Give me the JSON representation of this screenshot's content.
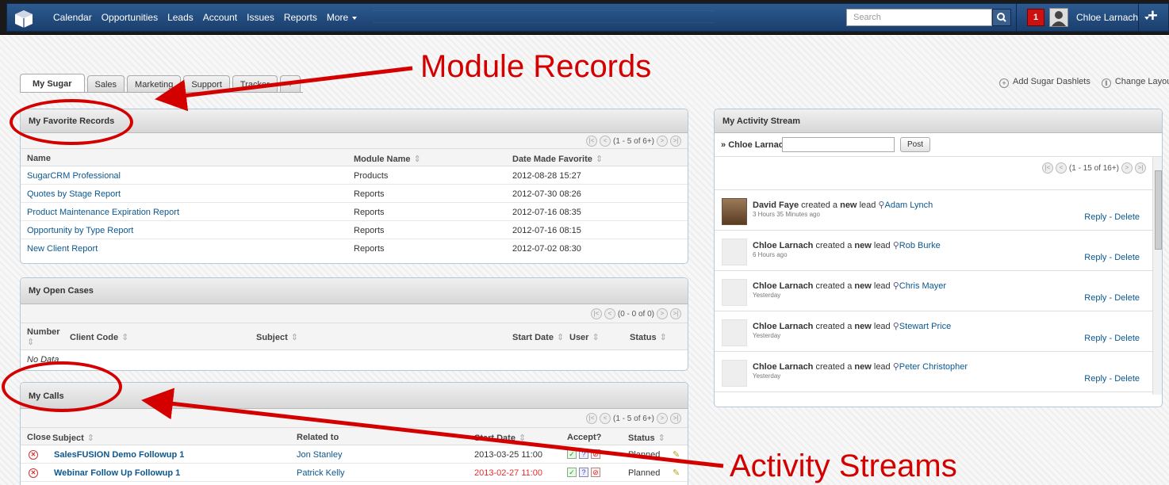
{
  "nav": {
    "items": [
      "Calendar",
      "Opportunities",
      "Leads",
      "Account",
      "Issues",
      "Reports",
      "More"
    ],
    "search_placeholder": "Search",
    "notifications": "1",
    "user": "Chloe Larnach"
  },
  "tabs": [
    "My Sugar",
    "Sales",
    "Marketing",
    "Support",
    "Tracker",
    "+"
  ],
  "dash_actions": {
    "add": "Add Sugar Dashlets",
    "layout": "Change Layout"
  },
  "favorites": {
    "title": "My Favorite Records",
    "pager": "(1 - 5 of 6+)",
    "columns": [
      "Name",
      "Module Name",
      "Date Made Favorite"
    ],
    "rows": [
      {
        "name": "SugarCRM Professional",
        "module": "Products",
        "date": "2012-08-28 15:27"
      },
      {
        "name": "Quotes by Stage Report",
        "module": "Reports",
        "date": "2012-07-30 08:26"
      },
      {
        "name": "Product Maintenance Expiration Report",
        "module": "Reports",
        "date": "2012-07-16 08:35"
      },
      {
        "name": "Opportunity by Type Report",
        "module": "Reports",
        "date": "2012-07-16 08:15"
      },
      {
        "name": "New Client Report",
        "module": "Reports",
        "date": "2012-07-02 08:30"
      }
    ]
  },
  "cases": {
    "title": "My Open Cases",
    "pager": "(0 - 0 of 0)",
    "columns": [
      "Number",
      "Client Code",
      "Subject",
      "Start Date",
      "User",
      "Status"
    ],
    "empty": "No Data"
  },
  "calls": {
    "title": "My Calls",
    "pager": "(1 - 5 of 6+)",
    "columns": [
      "Close",
      "Subject",
      "Related to",
      "Start Date",
      "Accept?",
      "Status"
    ],
    "rows": [
      {
        "subject": "SalesFUSION Demo Followup 1",
        "related": "Jon Stanley",
        "date": "2013-03-25 11:00",
        "status": "Planned",
        "overdue": false
      },
      {
        "subject": "Webinar Follow Up Followup 1",
        "related": "Patrick Kelly",
        "date": "2013-02-27 11:00",
        "status": "Planned",
        "overdue": true
      }
    ]
  },
  "activity": {
    "title": "My Activity Stream",
    "user_label": "Chloe Larnach",
    "post_label": "Post",
    "pager": "(1 - 15 of 16+)",
    "created_text": "created a",
    "new_text": "new",
    "lead_text": "lead",
    "reply": "Reply",
    "delete": "Delete",
    "items": [
      {
        "actor": "David Faye",
        "target": "Adam Lynch",
        "ago": "3 Hours 35 Minutes ago",
        "photo": true
      },
      {
        "actor": "Chloe Larnach",
        "target": "Rob Burke",
        "ago": "6 Hours ago",
        "photo": false
      },
      {
        "actor": "Chloe Larnach",
        "target": "Chris Mayer",
        "ago": "Yesterday",
        "photo": false
      },
      {
        "actor": "Chloe Larnach",
        "target": "Stewart Price",
        "ago": "Yesterday",
        "photo": false
      },
      {
        "actor": "Chloe Larnach",
        "target": "Peter Christopher",
        "ago": "Yesterday",
        "photo": false
      }
    ]
  },
  "annotations": {
    "module_records": "Module Records",
    "activity_streams": "Activity Streams"
  },
  "colors": {
    "annotation": "#d40000",
    "nav": "#2d5a8f",
    "link": "#0b578f",
    "overdue": "#e03030"
  }
}
